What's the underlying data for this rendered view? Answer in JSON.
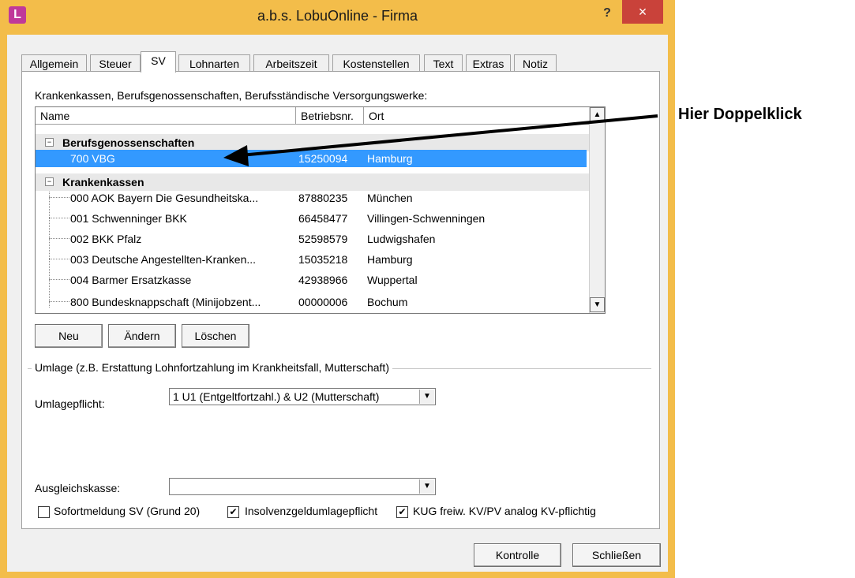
{
  "window": {
    "title": "a.b.s. LobuOnline - Firma",
    "help_label": "?",
    "close_label": "×",
    "icon_label": "L"
  },
  "tabs": [
    "Allgemein",
    "Steuer",
    "SV",
    "Lohnarten",
    "Arbeitszeit",
    "Kostenstellen",
    "Text",
    "Extras",
    "Notiz"
  ],
  "active_tab": "SV",
  "list_label": "Krankenkassen, Berufsgenossenschaften, Berufsständische Versorgungswerke:",
  "table": {
    "columns": [
      "Name",
      "Betriebsnr.",
      "Ort"
    ],
    "groups": [
      {
        "name": "Berufsgenossenschaften",
        "rows": [
          {
            "name": "700 VBG",
            "nr": "15250094",
            "ort": "Hamburg",
            "selected": true
          }
        ]
      },
      {
        "name": "Krankenkassen",
        "rows": [
          {
            "name": "000 AOK Bayern Die Gesundheitska...",
            "nr": "87880235",
            "ort": "München"
          },
          {
            "name": "001 Schwenninger BKK",
            "nr": "66458477",
            "ort": "Villingen-Schwenningen"
          },
          {
            "name": "002 BKK Pfalz",
            "nr": "52598579",
            "ort": "Ludwigshafen"
          },
          {
            "name": "003 Deutsche Angestellten-Kranken...",
            "nr": "15035218",
            "ort": "Hamburg"
          },
          {
            "name": "004 Barmer Ersatzkasse",
            "nr": "42938966",
            "ort": "Wuppertal"
          },
          {
            "name": "800 Bundesknappschaft (Minijobzent...",
            "nr": "00000006",
            "ort": "Bochum"
          }
        ]
      }
    ]
  },
  "buttons": {
    "neu": "Neu",
    "aendern": "Ändern",
    "loeschen": "Löschen",
    "kontrolle": "Kontrolle",
    "schliessen": "Schließen"
  },
  "umlage": {
    "group_label": "Umlage (z.B. Erstattung Lohnfortzahlung im Krankheitsfall, Mutterschaft)",
    "pflicht_label": "Umlagepflicht:",
    "pflicht_value": "1 U1 (Entgeltfortzahl.) & U2 (Mutterschaft)",
    "ausgleich_label": "Ausgleichskasse:",
    "ausgleich_value": ""
  },
  "checkboxes": [
    {
      "label": "Sofortmeldung SV (Grund 20)",
      "checked": false
    },
    {
      "label": "Insolvenzgeldumlagepflicht",
      "checked": true
    },
    {
      "label": "KUG freiw. KV/PV analog KV-pflichtig",
      "checked": true
    }
  ],
  "annotation": {
    "text": "Hier Doppelklick"
  },
  "colors": {
    "frame": "#f3bd4a",
    "close": "#c9423a",
    "selection": "#3399ff",
    "icon": "#c0399a"
  }
}
